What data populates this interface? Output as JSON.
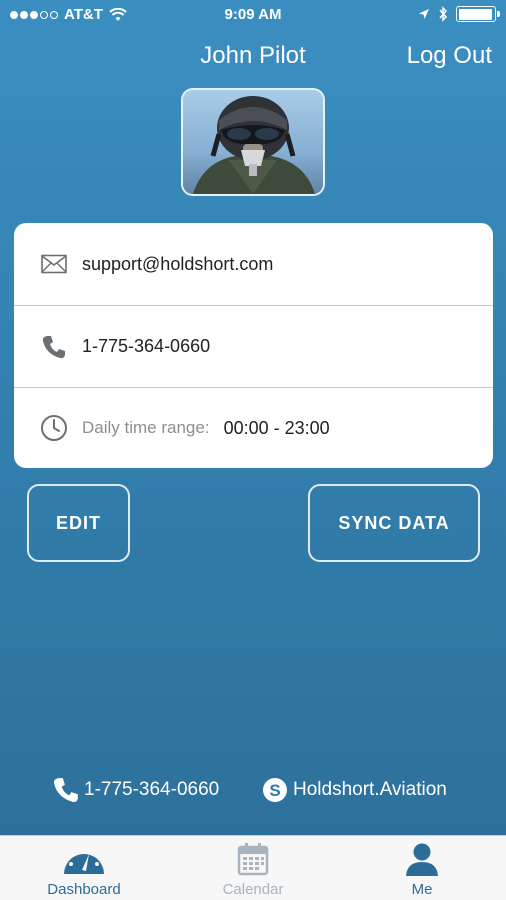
{
  "status_bar": {
    "carrier": "AT&T",
    "time": "9:09 AM",
    "signal_bars_filled": 3,
    "signal_bars_total": 5,
    "battery_level": 0.95
  },
  "header": {
    "user_name": "John Pilot",
    "logout_label": "Log Out"
  },
  "contact_card": {
    "email": "support@holdshort.com",
    "phone": "1-775-364-0660",
    "time_range_label": "Daily time range:",
    "time_range_value": "00:00 - 23:00"
  },
  "actions": {
    "edit_label": "EDIT",
    "sync_label": "SYNC DATA"
  },
  "footer": {
    "phone": "1-775-364-0660",
    "skype": "Holdshort.Aviation"
  },
  "tabbar": {
    "tabs": [
      {
        "label": "Dashboard",
        "icon": "dashboard-gauge-icon",
        "color": "#2c6c99"
      },
      {
        "label": "Calendar",
        "icon": "calendar-icon",
        "color": "#a8b4bf"
      },
      {
        "label": "Me",
        "icon": "person-icon",
        "color": "#2c6c99"
      }
    ],
    "active_tab": "Me"
  },
  "colors": {
    "background_top": "#3b8fc0",
    "background_bottom": "#2c6e98",
    "accent": "#2c6c99"
  }
}
